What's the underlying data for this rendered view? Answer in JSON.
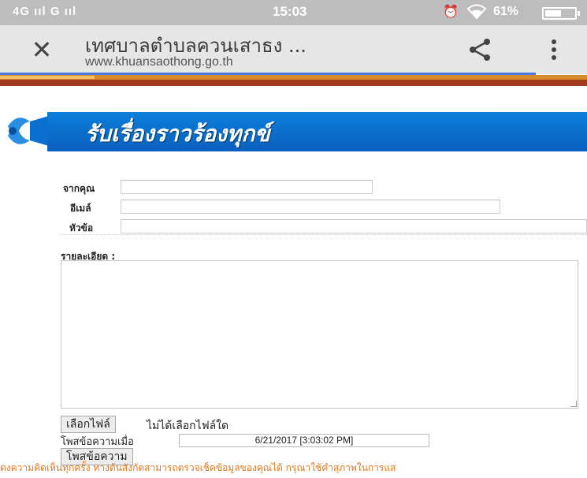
{
  "status_bar": {
    "signal": "4G ııl G ııl",
    "time": "15:03",
    "alarm_icon": "⏰",
    "wifi_icon": "wifi",
    "battery": "61%",
    "battery_level": 0.61
  },
  "toolbar": {
    "title": "เทศบาลตำบลควนเสาธง ...",
    "url": "www.khuansaothong.go.th"
  },
  "banner": {
    "title": "รับเรื่องราวร้องทุกข์"
  },
  "form": {
    "from_label": "จากคุณ",
    "from_value": "",
    "email_label": "อีเมล์",
    "email_value": "",
    "subject_label": "หัวข้อ",
    "subject_value": "",
    "detail_label": "รายละเอียด :",
    "detail_value": "",
    "choose_file_button": "เลือกไฟล์",
    "no_file_text": "ไม่ได้เลือกไฟล์ใด",
    "posted_at_label": "โพสข้อความเมื่อ",
    "posted_at_value": "6/21/2017 [3:03:02 PM]",
    "submit_button": "โพสข้อความ"
  },
  "footer": {
    "notice": "ดงความคิดเห็นทุกครั้ง ทางต้นสังกัดสามารถตรวจเช็คข้อมูลของคุณได้ กรุณาใช้คำสุภาพในการแส"
  },
  "colors": {
    "banner": "#0b6fd0",
    "footer_text": "#e2781e",
    "progress": "#4c7be0"
  }
}
